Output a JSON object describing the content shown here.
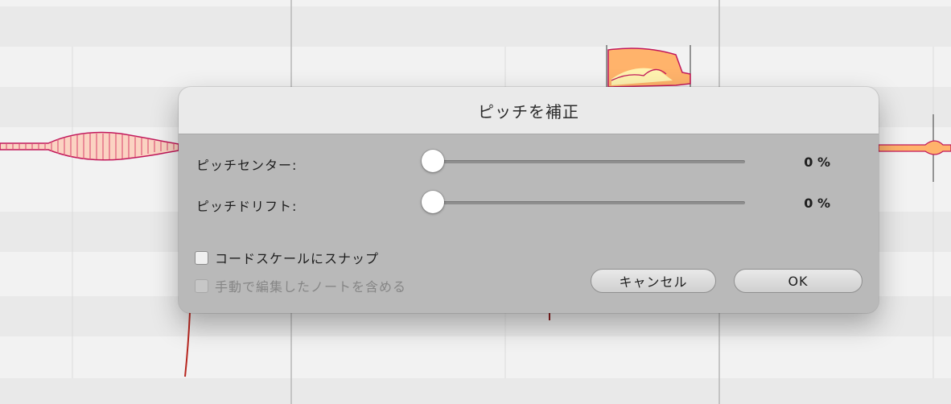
{
  "dialog": {
    "title": "ピッチを補正",
    "sliders": [
      {
        "label": "ピッチセンター:",
        "value": "0 %",
        "level": 0
      },
      {
        "label": "ピッチドリフト:",
        "value": "0 %",
        "level": 0
      }
    ],
    "checkboxes": [
      {
        "label": "コードスケールにスナップ",
        "checked": false,
        "enabled": true
      },
      {
        "label": "手動で編集したノートを含める",
        "checked": false,
        "enabled": false
      }
    ],
    "buttons": {
      "cancel": "キャンセル",
      "ok": "OK"
    }
  },
  "colors": {
    "blob_outline": "#c2185b",
    "blob_fill_light": "#fff3b0",
    "blob_fill_warm": "#ffb36b",
    "blob_stripe": "#e05a7a"
  }
}
